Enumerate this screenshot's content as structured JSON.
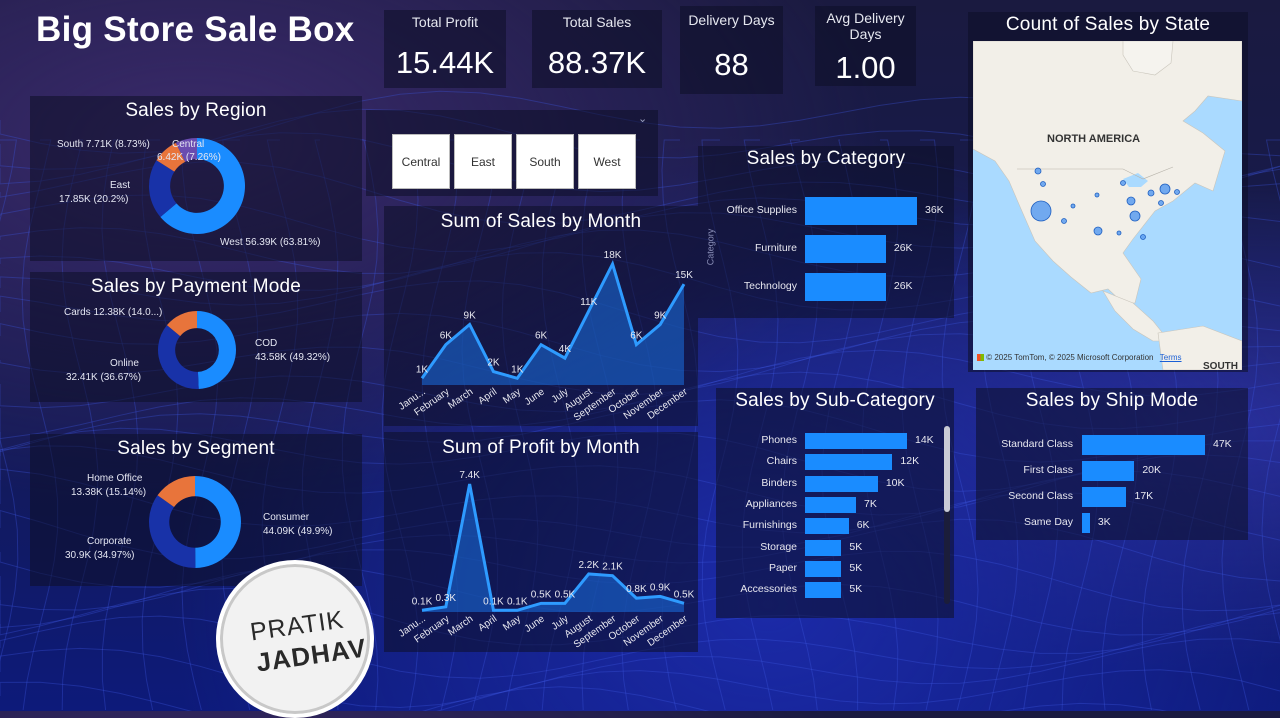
{
  "title": "Big Store Sale Box",
  "kpis": [
    {
      "label": "Total Profit",
      "value": "15.44K"
    },
    {
      "label": "Total Sales",
      "value": "88.37K"
    },
    {
      "label": "Delivery Days",
      "value": "88"
    },
    {
      "label": "Avg Delivery Days",
      "value": "1.00"
    }
  ],
  "region_chart": {
    "title": "Sales by Region",
    "labels": {
      "south": "South 7.71K (8.73%)",
      "central_name": "Central",
      "central_value": "6.42K (7.26%)",
      "east_name": "East",
      "east_value": "17.85K (20.2%)",
      "west": "West 56.39K (63.81%)"
    }
  },
  "payment_chart": {
    "title": "Sales by Payment Mode",
    "labels": {
      "cards": "Cards 12.38K (14.0...)",
      "cod_name": "COD",
      "cod_value": "43.58K (49.32%)",
      "online_name": "Online",
      "online_value": "32.41K (36.67%)"
    }
  },
  "segment_chart": {
    "title": "Sales by Segment",
    "labels": {
      "home_name": "Home Office",
      "home_value": "13.38K (15.14%)",
      "consumer_name": "Consumer",
      "consumer_value": "44.09K (49.9%)",
      "corporate_name": "Corporate",
      "corporate_value": "30.9K (34.97%)"
    }
  },
  "region_slicer": {
    "options": [
      "Central",
      "East",
      "South",
      "West"
    ]
  },
  "sales_month_chart": {
    "title": "Sum of Sales by Month"
  },
  "profit_month_chart": {
    "title": "Sum of Profit by Month"
  },
  "category_chart": {
    "title": "Sales by Category",
    "axis_label": "Category"
  },
  "subcategory_chart": {
    "title": "Sales by Sub-Category"
  },
  "shipmode_chart": {
    "title": "Sales by Ship Mode"
  },
  "map": {
    "title": "Count of Sales by State",
    "continent_label": "NORTH AMERICA",
    "south_label": "SOUTH A",
    "attribution": "© 2025 TomTom, © 2025 Microsoft Corporation",
    "terms": "Terms"
  },
  "watermark": {
    "line1": "PRATIK",
    "line2": "JADHAV"
  },
  "colors": {
    "accent": "#1a8cff",
    "dark_blue": "#1832a8",
    "orange": "#e8743b",
    "panel": "#0c0e26"
  },
  "chart_data": [
    {
      "type": "pie",
      "title": "Sales by Region",
      "categories": [
        "West",
        "East",
        "South",
        "Central"
      ],
      "values": [
        56.39,
        17.85,
        7.71,
        6.42
      ],
      "percent": [
        63.81,
        20.2,
        8.73,
        7.26
      ],
      "unit": "K",
      "colors": [
        "#1a8cff",
        "#1832a8",
        "#e8743b",
        "#6a4cb0"
      ]
    },
    {
      "type": "pie",
      "title": "Sales by Payment Mode",
      "categories": [
        "COD",
        "Online",
        "Cards"
      ],
      "values": [
        43.58,
        32.41,
        12.38
      ],
      "percent": [
        49.32,
        36.67,
        14.0
      ],
      "unit": "K",
      "colors": [
        "#1a8cff",
        "#1832a8",
        "#e8743b"
      ]
    },
    {
      "type": "pie",
      "title": "Sales by Segment",
      "categories": [
        "Consumer",
        "Corporate",
        "Home Office"
      ],
      "values": [
        44.09,
        30.9,
        13.38
      ],
      "percent": [
        49.9,
        34.97,
        15.14
      ],
      "unit": "K",
      "colors": [
        "#1a8cff",
        "#1832a8",
        "#e8743b"
      ]
    },
    {
      "type": "area",
      "title": "Sum of Sales by Month",
      "categories": [
        "January",
        "February",
        "March",
        "April",
        "May",
        "June",
        "July",
        "August",
        "September",
        "October",
        "November",
        "December"
      ],
      "values": [
        1,
        6,
        9,
        2,
        1,
        6,
        4,
        11,
        18,
        6,
        9,
        15
      ],
      "data_labels": [
        "1K",
        "6K",
        "9K",
        "2K",
        "1K",
        "6K",
        "4K",
        "11K",
        "18K",
        "6K",
        "9K",
        "15K"
      ],
      "x_labels": [
        "Janu...",
        "February",
        "March",
        "April",
        "May",
        "June",
        "July",
        "August",
        "September",
        "October",
        "November",
        "December"
      ],
      "unit": "K"
    },
    {
      "type": "area",
      "title": "Sum of Profit by Month",
      "categories": [
        "January",
        "February",
        "March",
        "April",
        "May",
        "June",
        "July",
        "August",
        "September",
        "October",
        "November",
        "December"
      ],
      "values": [
        0.1,
        0.3,
        7.4,
        0.1,
        0.1,
        0.5,
        0.5,
        2.2,
        2.1,
        0.8,
        0.9,
        0.5
      ],
      "data_labels": [
        "0.1K",
        "0.3K",
        "7.4K",
        "0.1K",
        "0.1K",
        "0.5K",
        "0.5K",
        "2.2K",
        "2.1K",
        "0.8K",
        "0.9K",
        "0.5K"
      ],
      "x_labels": [
        "Janu...",
        "February",
        "March",
        "April",
        "May",
        "June",
        "July",
        "August",
        "September",
        "October",
        "November",
        "December"
      ],
      "unit": "K"
    },
    {
      "type": "bar",
      "title": "Sales by Category",
      "categories": [
        "Office Supplies",
        "Furniture",
        "Technology"
      ],
      "values": [
        36,
        26,
        26
      ],
      "data_labels": [
        "36K",
        "26K",
        "26K"
      ],
      "unit": "K"
    },
    {
      "type": "bar",
      "title": "Sales by Sub-Category",
      "categories": [
        "Phones",
        "Chairs",
        "Binders",
        "Appliances",
        "Furnishings",
        "Storage",
        "Paper",
        "Accessories"
      ],
      "values": [
        14,
        12,
        10,
        7,
        6,
        5,
        5,
        5
      ],
      "data_labels": [
        "14K",
        "12K",
        "10K",
        "7K",
        "6K",
        "5K",
        "5K",
        "5K"
      ],
      "unit": "K"
    },
    {
      "type": "bar",
      "title": "Sales by Ship Mode",
      "categories": [
        "Standard Class",
        "First Class",
        "Second Class",
        "Same Day"
      ],
      "values": [
        47,
        20,
        17,
        3
      ],
      "data_labels": [
        "47K",
        "20K",
        "17K",
        "3K"
      ],
      "unit": "K"
    }
  ]
}
